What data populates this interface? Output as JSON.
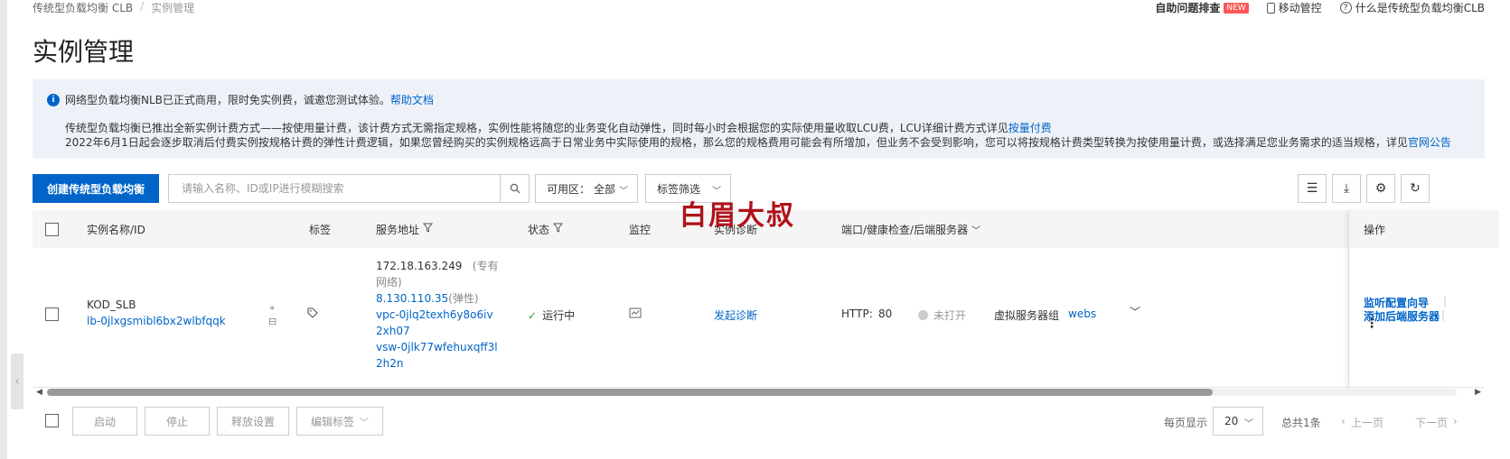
{
  "breadcrumb": [
    "传统型负载均衡 CLB",
    "实例管理"
  ],
  "top_links": {
    "self_diag": "自助问题排查",
    "new_badge": "NEW",
    "mobile": "移动管控",
    "what_is": "什么是传统型负载均衡CLB"
  },
  "page_title": "实例管理",
  "notice": {
    "line1": "网络型负载均衡NLB已正式商用，限时免实例费，诚邀您测试体验。",
    "line1_link": "帮助文档",
    "line2": "传统型负载均衡已推出全新实例计费方式——按使用量计费，该计费方式无需指定规格，实例性能将随您的业务变化自动弹性，同时每小时会根据您的实际使用量收取LCU费，LCU详细计费方式详见",
    "line2_link": "按量付费",
    "line3": "2022年6月1日起会逐步取消后付费实例按规格计费的弹性计费逻辑，如果您曾经购买的实例规格远高于日常业务中实际使用的规格，那么您的规格费用可能会有所增加，但业务不会受到影响，您可以将按规格计费类型转换为按使用量计费，或选择满足您业务需求的适当规格，详见",
    "line3_link": "官网公告"
  },
  "toolbar": {
    "create_label": "创建传统型负载均衡",
    "search_placeholder": "请输入名称、ID或IP进行模糊搜索",
    "zone_label": "可用区：",
    "zone_value": "全部",
    "tag_filter": "标签筛选"
  },
  "columns": {
    "name": "实例名称/ID",
    "tags": "标签",
    "address": "服务地址",
    "status": "状态",
    "monitor": "监控",
    "diag": "实例诊断",
    "ports": "端口/健康检查/后端服务器",
    "ops": "操作"
  },
  "row": {
    "name": "KOD_SLB",
    "id": "lb-0jlxgsmibl6bx2wlbfqqk",
    "ip_private": "172.18.163.249",
    "ip_private_type": "(专有网络)",
    "ip_public": "8.130.110.35",
    "ip_public_type": "(弹性)",
    "vpc": "vpc-0jlq2texh6y8o6iv2xh07",
    "vsw": "vsw-0jlk77wfehuxqff3l2h2n",
    "status": "运行中",
    "diag_link": "发起诊断",
    "protocol": "HTTP:",
    "port": "80",
    "health": "未打开",
    "server_group_type": "虚拟服务器组",
    "server_group": "webs",
    "op1": "监听配置向导",
    "op2": "添加后端服务器"
  },
  "footer": {
    "start": "启动",
    "stop": "停止",
    "release": "释放设置",
    "edit_tags": "编辑标签",
    "page_size_label": "每页显示",
    "page_size": "20",
    "total": "总共1条",
    "prev": "上一页",
    "next": "下一页"
  },
  "watermark": "白眉大叔",
  "colors": {
    "primary": "#0064c8",
    "notice_bg": "#eef2f8",
    "success": "#2ca02c",
    "watermark": "#b0121a"
  }
}
